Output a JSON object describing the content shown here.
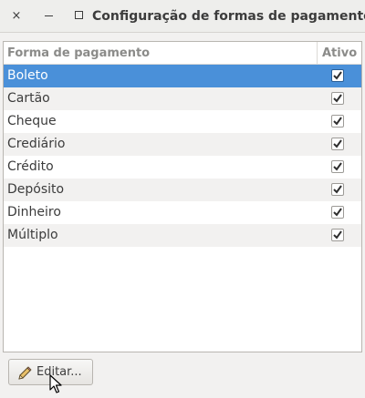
{
  "window": {
    "title": "Configuração de formas de pagamento",
    "close_symbol": "×"
  },
  "table": {
    "columns": [
      "Forma de pagamento",
      "Ativo"
    ],
    "rows": [
      {
        "label": "Boleto",
        "active": true,
        "selected": true
      },
      {
        "label": "Cartão",
        "active": true,
        "selected": false
      },
      {
        "label": "Cheque",
        "active": true,
        "selected": false
      },
      {
        "label": "Crediário",
        "active": true,
        "selected": false
      },
      {
        "label": "Crédito",
        "active": true,
        "selected": false
      },
      {
        "label": "Depósito",
        "active": true,
        "selected": false
      },
      {
        "label": "Dinheiro",
        "active": true,
        "selected": false
      },
      {
        "label": "Múltiplo",
        "active": true,
        "selected": false
      }
    ]
  },
  "actions": {
    "edit_label": "Editar..."
  },
  "colors": {
    "selection": "#4a90d9",
    "window_bg": "#f2f1f0"
  },
  "icons": {
    "close": "close-icon",
    "minimize": "minimize-icon",
    "maximize": "maximize-icon",
    "edit": "pencil-icon",
    "pointer": "mouse-cursor-icon"
  }
}
